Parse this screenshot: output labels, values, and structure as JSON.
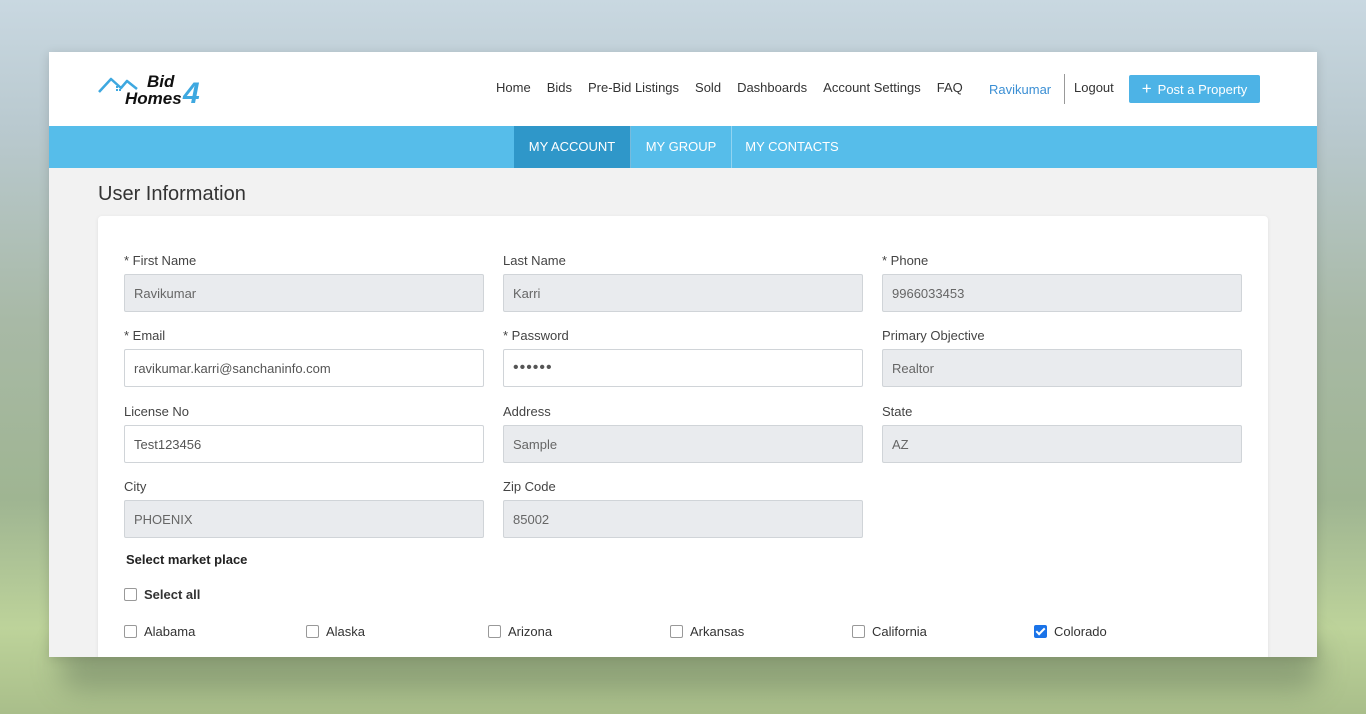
{
  "brand": {
    "logo_line1": "Bid",
    "logo_line2": "Homes",
    "logo_num": "4"
  },
  "nav": {
    "items": [
      "Home",
      "Bids",
      "Pre-Bid Listings",
      "Sold",
      "Dashboards",
      "Account Settings",
      "FAQ"
    ],
    "user": "Ravikumar",
    "logout": "Logout",
    "post_button": "Post a Property"
  },
  "tabs": [
    "MY ACCOUNT",
    "MY GROUP",
    "MY CONTACTS"
  ],
  "page_title": "User Information",
  "form": {
    "first_name": {
      "label": "* First Name",
      "value": "Ravikumar"
    },
    "last_name": {
      "label": "Last Name",
      "value": "Karri"
    },
    "phone": {
      "label": "* Phone",
      "value": "9966033453"
    },
    "email": {
      "label": "* Email",
      "value": "ravikumar.karri@sanchaninfo.com"
    },
    "password": {
      "label": "* Password",
      "value": "••••••"
    },
    "objective": {
      "label": "Primary Objective",
      "value": "Realtor"
    },
    "license": {
      "label": "License No",
      "value": "Test123456"
    },
    "address": {
      "label": "Address",
      "value": "Sample"
    },
    "state": {
      "label": "State",
      "value": "AZ"
    },
    "city": {
      "label": "City",
      "value": "PHOENIX"
    },
    "zip": {
      "label": "Zip Code",
      "value": "85002"
    }
  },
  "market": {
    "title": "Select market place",
    "select_all": "Select all",
    "states": [
      {
        "name": "Alabama",
        "checked": false
      },
      {
        "name": "Alaska",
        "checked": false
      },
      {
        "name": "Arizona",
        "checked": false
      },
      {
        "name": "Arkansas",
        "checked": false
      },
      {
        "name": "California",
        "checked": false
      },
      {
        "name": "Colorado",
        "checked": true
      }
    ]
  }
}
